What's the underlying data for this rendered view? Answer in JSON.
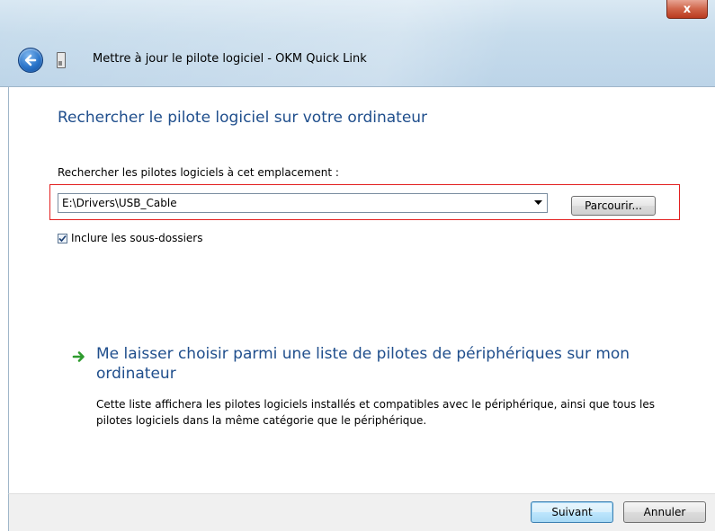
{
  "window": {
    "title": "Mettre à jour le pilote logiciel - OKM Quick Link",
    "close_glyph": "x"
  },
  "main": {
    "heading": "Rechercher le pilote logiciel sur votre ordinateur",
    "location_label": "Rechercher les pilotes logiciels à cet emplacement :",
    "path_value": "E:\\Drivers\\USB_Cable",
    "browse_label": "Parcourir...",
    "include_subfolders_label": "Inclure les sous-dossiers",
    "include_subfolders_checked": true,
    "choice_title": "Me laisser choisir parmi une liste de pilotes de périphériques sur mon ordinateur",
    "choice_description": "Cette liste affichera les pilotes logiciels installés et compatibles avec le périphérique, ainsi que tous les pilotes logiciels dans la même catégorie que le périphérique."
  },
  "footer": {
    "next_label": "Suivant",
    "cancel_label": "Annuler"
  },
  "icons": {
    "back": "back-arrow-icon",
    "device": "usb-device-icon",
    "choice": "green-arrow-icon"
  },
  "colors": {
    "heading": "#1f4e8c",
    "highlight_border": "#e32020",
    "choice_arrow": "#2e9b2e"
  }
}
